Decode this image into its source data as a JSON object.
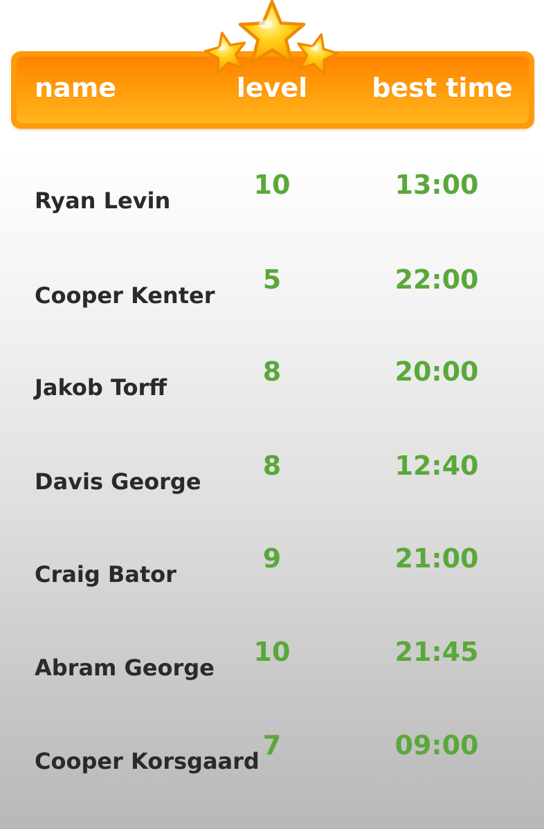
{
  "header": {
    "name_label": "name",
    "level_label": "level",
    "time_label": "best time"
  },
  "decor": {
    "icon": "three-stars-icon"
  },
  "colors": {
    "header_orange": "#ff9a0c",
    "name_text": "#2a2a2a",
    "value_green": "#5aa83a",
    "star_yellow": "#ffd21a"
  },
  "rows": [
    {
      "name": "Ryan Levin",
      "level": "10",
      "time": "13:00"
    },
    {
      "name": "Cooper Kenter",
      "level": "5",
      "time": "22:00"
    },
    {
      "name": "Jakob Torff",
      "level": "8",
      "time": "20:00"
    },
    {
      "name": "Davis George",
      "level": "8",
      "time": "12:40"
    },
    {
      "name": "Craig Bator",
      "level": "9",
      "time": "21:00"
    },
    {
      "name": "Abram George",
      "level": "10",
      "time": "21:45"
    },
    {
      "name": "Cooper Korsgaard",
      "level": "7",
      "time": "09:00"
    }
  ]
}
